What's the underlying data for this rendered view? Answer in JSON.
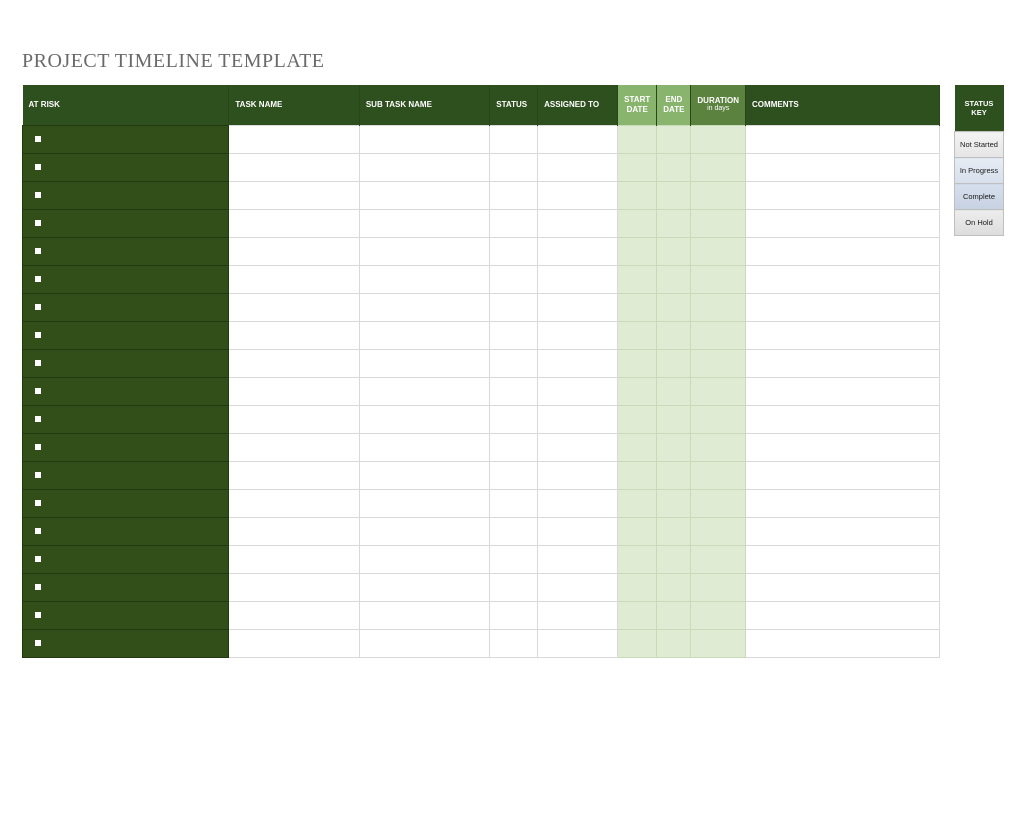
{
  "title": "PROJECT TIMELINE TEMPLATE",
  "columns": {
    "at_risk": "AT RISK",
    "task_name": "TASK NAME",
    "sub_task_name": "SUB TASK NAME",
    "status": "STATUS",
    "assigned_to": "ASSIGNED TO",
    "start_date": "START DATE",
    "end_date": "END DATE",
    "duration": "DURATION",
    "duration_sub": "in days",
    "comments": "COMMENTS"
  },
  "status_key": {
    "header": "STATUS KEY",
    "items": [
      "Not Started",
      "In Progress",
      "Complete",
      "On Hold"
    ]
  },
  "row_count": 19
}
